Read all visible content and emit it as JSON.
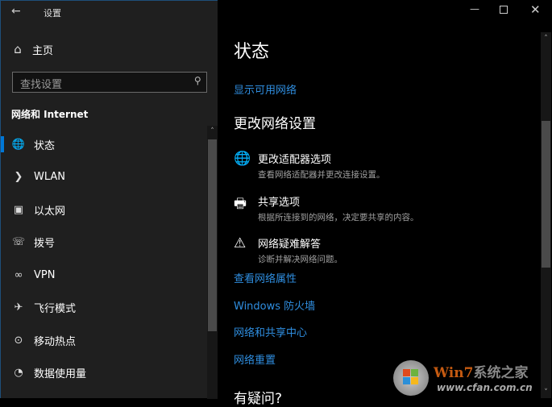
{
  "window": {
    "title": "设置",
    "back_icon": "arrow-left-icon",
    "controls": [
      "minimize",
      "maximize",
      "close"
    ]
  },
  "sidebar": {
    "home": "主页",
    "search_placeholder": "查找设置",
    "section": "网络和 Internet",
    "items": [
      {
        "label": "状态",
        "icon": "globe-status-icon",
        "selected": true
      },
      {
        "label": "WLAN",
        "icon": "wifi-icon"
      },
      {
        "label": "以太网",
        "icon": "ethernet-icon"
      },
      {
        "label": "拨号",
        "icon": "dialup-icon"
      },
      {
        "label": "VPN",
        "icon": "vpn-icon"
      },
      {
        "label": "飞行模式",
        "icon": "airplane-icon"
      },
      {
        "label": "移动热点",
        "icon": "hotspot-icon"
      },
      {
        "label": "数据使用量",
        "icon": "data-usage-icon"
      }
    ]
  },
  "main": {
    "title": "状态",
    "show_networks": "显示可用网络",
    "section": "更改网络设置",
    "options": [
      {
        "title": "更改适配器选项",
        "desc": "查看网络适配器并更改连接设置。",
        "icon": "adapter-icon"
      },
      {
        "title": "共享选项",
        "desc": "根据所连接到的网络，决定要共享的内容。",
        "icon": "sharing-icon"
      },
      {
        "title": "网络疑难解答",
        "desc": "诊断并解决网络问题。",
        "icon": "warning-icon"
      }
    ],
    "links": [
      "查看网络属性",
      "Windows 防火墙",
      "网络和共享中心",
      "网络重置"
    ],
    "question": "有疑问?"
  },
  "watermark": {
    "brand": "Win7系统之家",
    "url": "www.cfan.com.cn"
  },
  "colors": {
    "accent": "#0078d7",
    "link": "#2f8ee0",
    "sidebar_bg": "#1f1f1f"
  }
}
